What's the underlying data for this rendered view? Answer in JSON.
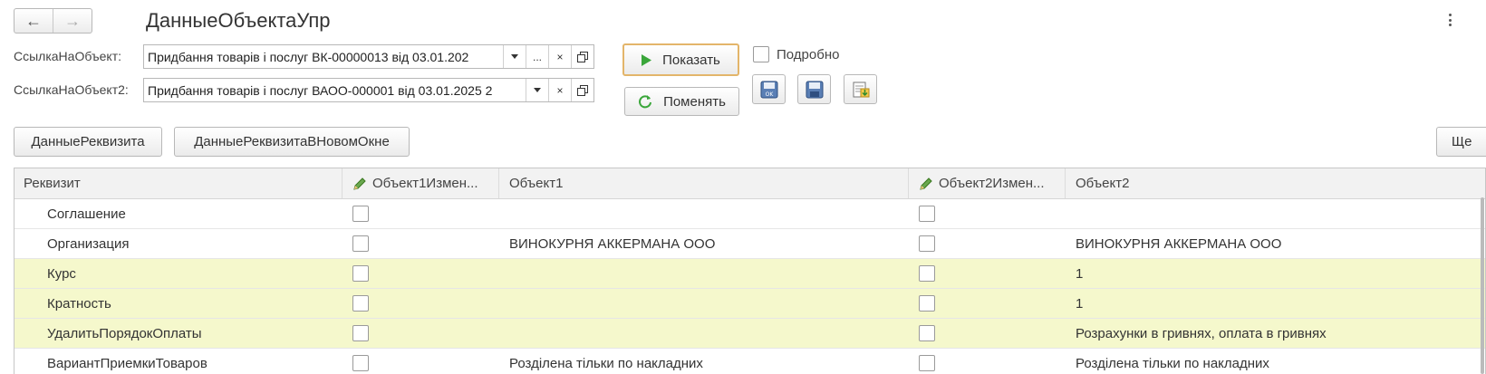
{
  "window": {
    "title": "ДанныеОбъектаУпр",
    "back_label": "←",
    "forward_label": "→"
  },
  "form": {
    "ref1_label": "СсылкаНаОбъект:",
    "ref1_value": "Придбання товарів і послуг ВК-00000013 від 03.01.202",
    "ref2_label": "СсылкаНаОбъект2:",
    "ref2_value": "Придбання товарів і послуг ВАОО-000001 від 03.01.2025 2",
    "dots_label": "...",
    "clear_label": "×",
    "show_label": "Показать",
    "swap_label": "Поменять",
    "detail_label": "Подробно"
  },
  "toolbar": {
    "attr_data_label": "ДанныеРеквизита",
    "attr_data_new_window_label": "ДанныеРеквизитаВНовомОкне",
    "more_label": "Ще"
  },
  "table": {
    "columns": [
      "Реквизит",
      "Объект1Измен...",
      "Объект1",
      "Объект2Измен...",
      "Объект2"
    ],
    "rows": [
      {
        "name": "Соглашение",
        "obj1": "",
        "obj2": "",
        "highlight": false
      },
      {
        "name": "Организация",
        "obj1": "ВИНОКУРНЯ АККЕРМАНА ООО",
        "obj2": "ВИНОКУРНЯ АККЕРМАНА ООО",
        "highlight": false
      },
      {
        "name": "Курс",
        "obj1": "",
        "obj2": "1",
        "highlight": true
      },
      {
        "name": "Кратность",
        "obj1": "",
        "obj2": "1",
        "highlight": true
      },
      {
        "name": "УдалитьПорядокОплаты",
        "obj1": "",
        "obj2": "Розрахунки в гривнях, оплата в гривнях",
        "highlight": true
      },
      {
        "name": "ВариантПриемкиТоваров",
        "obj1": "Розділена тільки по накладних",
        "obj2": "Розділена тільки по накладних",
        "highlight": false
      }
    ]
  },
  "colors": {
    "highlight_row": "#f5f8cc",
    "default_button_border": "#e3b56a",
    "play_icon": "#3aa63a"
  }
}
